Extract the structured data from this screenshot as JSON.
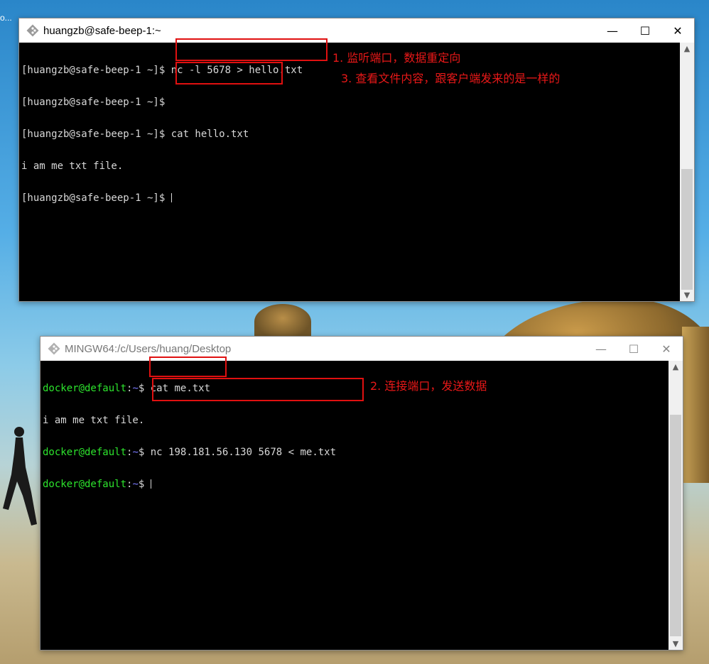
{
  "desktop": {
    "label": "o..."
  },
  "window1": {
    "title": "huangzb@safe-beep-1:~",
    "controls": {
      "minimize": "—",
      "maximize": "☐",
      "close": "✕"
    },
    "lines": [
      {
        "prompt": "[huangzb@safe-beep-1 ~]$ ",
        "cmd": "nc -l 5678 > hello.txt"
      },
      {
        "prompt": "[huangzb@safe-beep-1 ~]$ ",
        "cmd": ""
      },
      {
        "prompt": "[huangzb@safe-beep-1 ~]$ ",
        "cmd": "cat hello.txt"
      },
      {
        "output": "i am me txt file."
      },
      {
        "prompt": "[huangzb@safe-beep-1 ~]$ ",
        "cmd": ""
      }
    ],
    "annotations": {
      "note1": "1. 监听端口，数据重定向",
      "note3": "3. 查看文件内容，跟客户端发来的是一样的"
    }
  },
  "window2": {
    "title": "MINGW64:/c/Users/huang/Desktop",
    "controls": {
      "minimize": "—",
      "maximize": "☐",
      "close": "✕"
    },
    "lines": [
      {
        "user": "docker@default",
        "sep": ":",
        "path": "~",
        "sym": "$ ",
        "cmd": "cat me.txt"
      },
      {
        "output": "i am me txt file."
      },
      {
        "user": "docker@default",
        "sep": ":",
        "path": "~",
        "sym": "$ ",
        "cmd": "nc 198.181.56.130 5678 < me.txt"
      },
      {
        "user": "docker@default",
        "sep": ":",
        "path": "~",
        "sym": "$ ",
        "cmd": ""
      }
    ],
    "annotations": {
      "note2": "2. 连接端口，发送数据"
    }
  },
  "icons": {
    "app": "git-diamond-icon",
    "scroll_up": "chevron-up-icon",
    "scroll_down": "chevron-down-icon"
  },
  "colors": {
    "annotation": "#e01010",
    "prompt_green": "#2de42d",
    "prompt_blue": "#7a7aff"
  }
}
